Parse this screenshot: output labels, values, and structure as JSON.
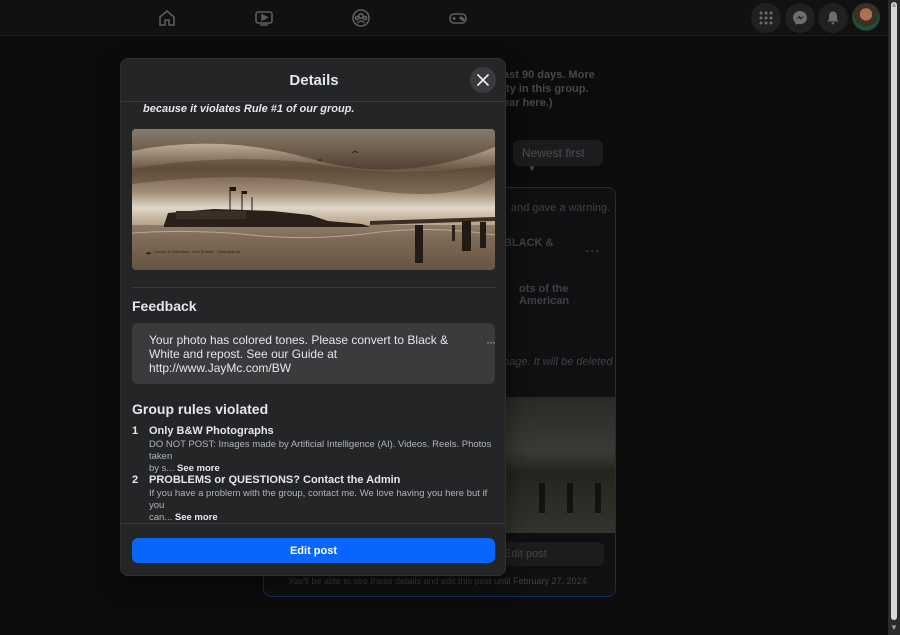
{
  "background": {
    "notice_lines": [
      "ast 90 days. More",
      "ity in this group.",
      "ear here.)"
    ],
    "sort_label": "Newest first",
    "card": {
      "warning": "and gave a warning.",
      "post_title": "BLACK &",
      "post_sub": "ots of the American",
      "deleted_note": "page. It will be deleted",
      "edit_label": "Edit post",
      "footer_note": "You'll be able to see these details and edit this post until February 27, 2024"
    }
  },
  "modal": {
    "title": "Details",
    "cut_text": "because it violates Rule #1 of our group.",
    "photo_caption": "Corner & Reflection · Fort Sumter · Photography",
    "feedback_title": "Feedback",
    "feedback_lines": [
      "Your photo has colored tones. Please convert to Black &",
      "White and repost. See our Guide at",
      "http://www.JayMc.com/BW"
    ],
    "feedback_more": "···",
    "rules_title": "Group rules violated",
    "rules": [
      {
        "num": "1",
        "title": "Only B&W Photographs",
        "desc_line1": "DO NOT POST: Images made by Artificial Intelligence (AI). Videos. Reels. Photos taken",
        "desc_line2": "by s...",
        "see_more": "See more"
      },
      {
        "num": "2",
        "title": "PROBLEMS or QUESTIONS? Contact the Admin",
        "desc_line1": "If you have a problem with the group, contact me. We love having you here but if you",
        "desc_line2": "can...",
        "see_more": "See more"
      }
    ],
    "edit_button": "Edit post"
  },
  "colors": {
    "accent": "#0866ff",
    "modal_bg": "#242526",
    "input_bg": "#3a3b3c"
  },
  "icons": [
    "home-icon",
    "video-icon",
    "groups-icon",
    "gaming-icon",
    "menu-grid-icon",
    "messenger-icon",
    "bell-icon",
    "close-icon"
  ]
}
